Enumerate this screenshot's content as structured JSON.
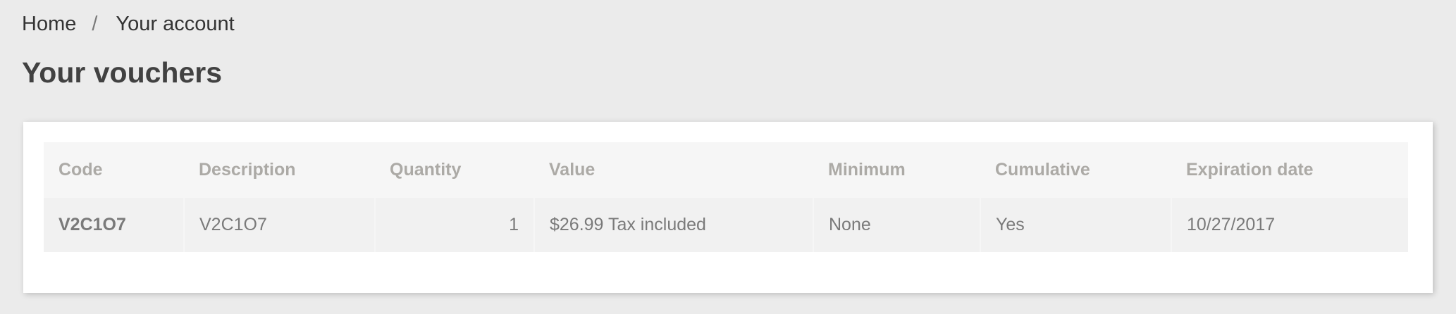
{
  "breadcrumb": {
    "home": "Home",
    "separator": "/",
    "current": "Your account"
  },
  "page": {
    "title": "Your vouchers"
  },
  "vouchers_table": {
    "headers": {
      "code": "Code",
      "description": "Description",
      "quantity": "Quantity",
      "value": "Value",
      "minimum": "Minimum",
      "cumulative": "Cumulative",
      "expiration_date": "Expiration date"
    },
    "rows": [
      {
        "code": "V2C1O7",
        "description": "V2C1O7",
        "quantity": "1",
        "value": "$26.99 Tax included",
        "minimum": "None",
        "cumulative": "Yes",
        "expiration_date": "10/27/2017"
      }
    ]
  },
  "colors": {
    "background": "#ebebeb",
    "card": "#ffffff",
    "header_row": "#f6f6f6",
    "body_row": "#f1f1f1",
    "header_text": "#acaaa6",
    "body_text": "#7a7a7a",
    "title_text": "#414141"
  }
}
